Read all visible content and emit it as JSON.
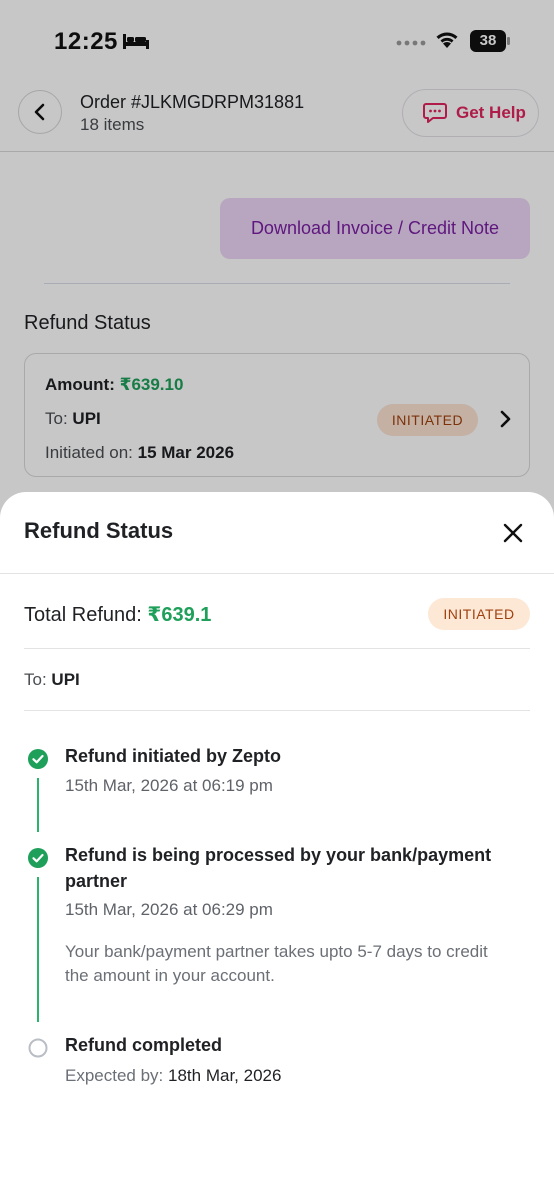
{
  "status_bar": {
    "time": "12:25",
    "battery": "38"
  },
  "header": {
    "order_title": "Order #JLKMGDRPM31881",
    "order_subtitle": "18 items",
    "help_label": "Get Help"
  },
  "invoice_button": "Download Invoice / Credit Note",
  "background_refund": {
    "section_title": "Refund Status",
    "amount_label": "Amount:",
    "amount_value": "₹639.10",
    "to_label": "To:",
    "to_value": "UPI",
    "initiated_label": "Initiated on:",
    "initiated_value": "15 Mar 2026",
    "status_badge": "INITIATED"
  },
  "sheet": {
    "title": "Refund Status",
    "total_label": "Total Refund:",
    "total_value": "₹639.1",
    "status_badge": "INITIATED",
    "to_label": "To:",
    "to_value": "UPI",
    "steps": [
      {
        "title": "Refund initiated by Zepto",
        "time": "15th Mar, 2026 at 06:19 pm",
        "completed": true
      },
      {
        "title": "Refund is being processed by your bank/payment partner",
        "time": "15th Mar, 2026 at 06:29 pm",
        "note": "Your bank/payment partner takes upto 5-7 days to credit the amount in your account.",
        "completed": true
      },
      {
        "title": "Refund completed",
        "expected_label": "Expected by:",
        "expected_value": "18th Mar, 2026",
        "completed": false
      }
    ]
  },
  "colors": {
    "accent_green": "#1e9f5a",
    "help_pink": "#e0245e",
    "invoice_purple": "#7a1fa2",
    "badge_bg": "#fde8d6",
    "badge_text": "#a0410e"
  }
}
